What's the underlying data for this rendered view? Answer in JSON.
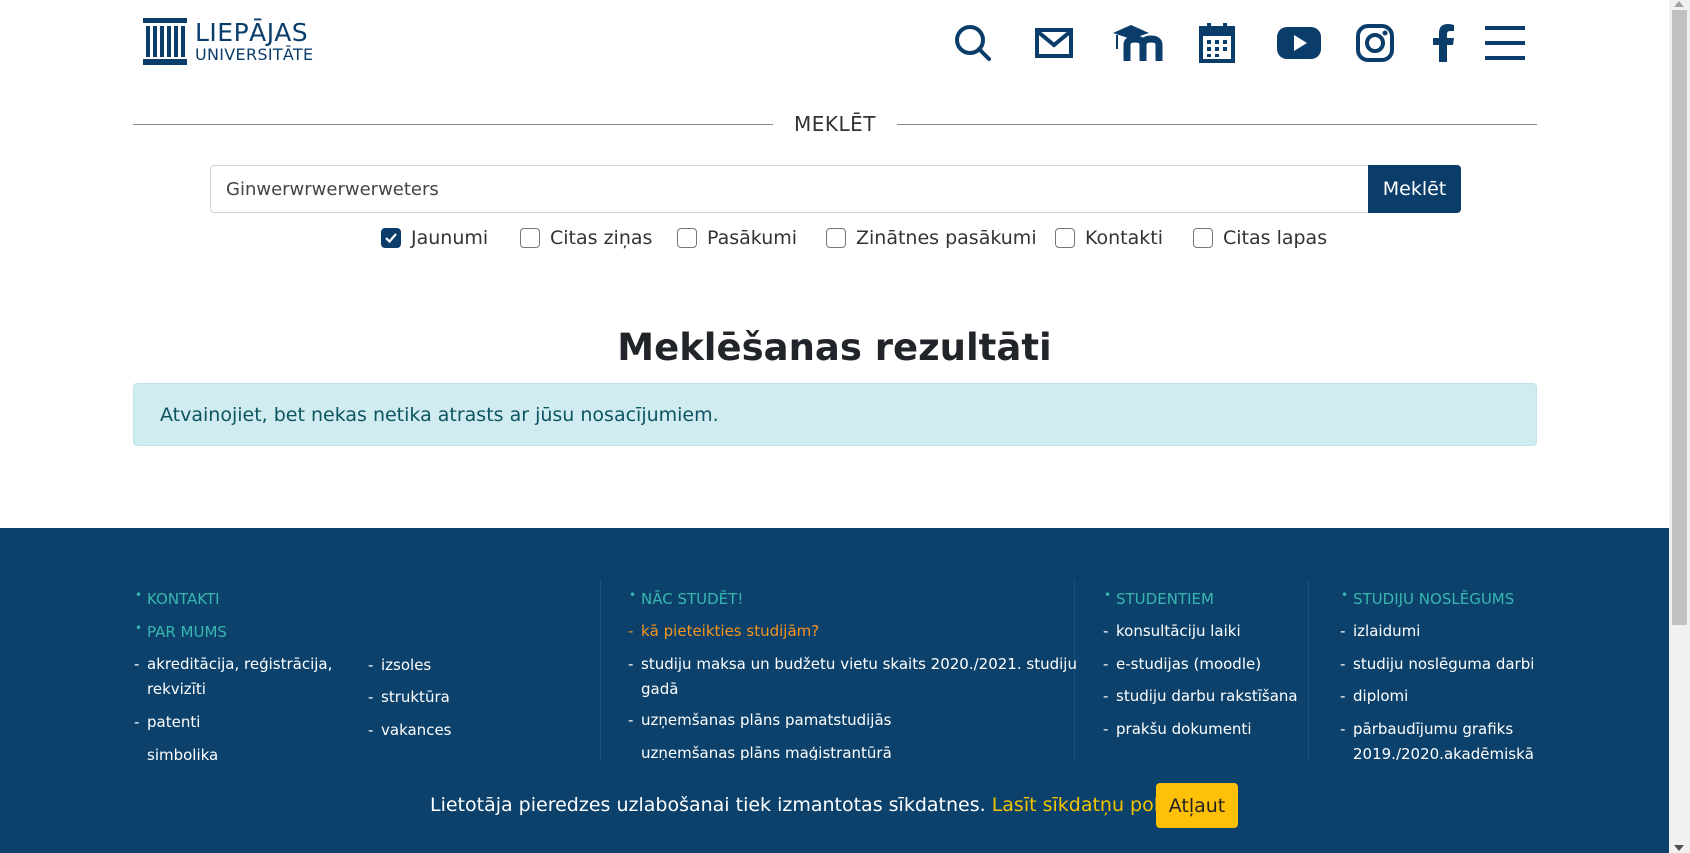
{
  "logo": {
    "line1": "LIEPĀJAS",
    "line2": "UNIVERSITĀTE"
  },
  "header_icons": [
    "search-icon",
    "mail-icon",
    "moodle-icon",
    "calendar-icon",
    "youtube-icon",
    "instagram-icon",
    "facebook-icon",
    "menu-icon"
  ],
  "search": {
    "section_title": "MEKLĒT",
    "query": "Ginwerwrwerwerweters",
    "button_label": "Meklēt",
    "filters": [
      {
        "label": "Jaunumi",
        "checked": true
      },
      {
        "label": "Citas ziņas",
        "checked": false
      },
      {
        "label": "Pasākumi",
        "checked": false
      },
      {
        "label": "Zinātnes pasākumi",
        "checked": false
      },
      {
        "label": "Kontakti",
        "checked": false
      },
      {
        "label": "Citas lapas",
        "checked": false
      }
    ]
  },
  "results": {
    "title": "Meklēšanas rezultāti",
    "message": "Atvainojiet, bet nekas netika atrasts ar jūsu nosacījumiem."
  },
  "footer": {
    "col1": {
      "heading1": "KONTAKTI",
      "heading2": "PAR MUMS",
      "left_items": [
        "akreditācija, reģistrācija,",
        "rekvizīti",
        "patenti",
        "simbolika"
      ],
      "right_items": [
        "izsoles",
        "struktūra",
        "vakances"
      ]
    },
    "col2": {
      "heading": "NĀC STUDĒT!",
      "items": [
        "kā pieteikties studijām?",
        "studiju maksa un budžetu vietu skaits 2020./2021. studiju",
        "gadā",
        "uzņemšanas plāns pamatstudijās",
        "uzņemšanas plāns maģistrantūrā"
      ]
    },
    "col3": {
      "heading": "STUDENTIEM",
      "items": [
        "konsultāciju laiki",
        "e-studijas (moodle)",
        "studiju darbu rakstīšana",
        "prakšu dokumenti"
      ]
    },
    "col4": {
      "heading": "STUDIJU NOSLĒGUMS",
      "items": [
        "izlaidumi",
        "studiju noslēguma darbi",
        "diplomi",
        "pārbaudījumu grafiks",
        "2019./2020.akadēmiskā"
      ]
    }
  },
  "cookie": {
    "text": "Lietotāja pieredzes uzlabošanai tiek izmantotas sīkdatnes.",
    "link": "Lasīt sīkdatņu politiku",
    "period": ".",
    "button": "Atļaut"
  },
  "colors": {
    "brand": "#0b3d6b",
    "footer_bg": "#0b416a",
    "footer_heading": "#39b6b0",
    "highlight_orange": "#f7941d",
    "cookie_button": "#ffc107",
    "alert_bg": "#d1ecf1"
  }
}
